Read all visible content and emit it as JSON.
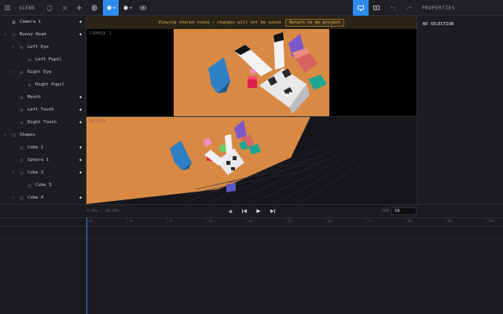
{
  "toolbar": {
    "menu_icon": "hamburger-menu-icon",
    "scene_label": "SCENE",
    "save_icon": "shield-icon",
    "close_icon": "close-icon",
    "add_icon": "plus-icon",
    "target_icon": "crosshair-icon",
    "shape_tool_icon": "circle-icon",
    "material_tool_icon": "sphere-icon",
    "view_icon": "eye-icon",
    "monitor_icon": "monitor-icon",
    "video_icon": "video-icon",
    "undo_icon": "undo-icon",
    "redo_icon": "redo-icon"
  },
  "scene_tree": [
    {
      "label": "Camera 1",
      "icon": "camera-icon",
      "depth": 0,
      "expandable": false,
      "visible_marker": true
    },
    {
      "label": "Bunny Head",
      "icon": "circle-icon",
      "depth": 0,
      "expandable": true,
      "visible_marker": true
    },
    {
      "label": "Left Eye",
      "icon": "diamond-icon",
      "depth": 1,
      "expandable": true,
      "visible_marker": false
    },
    {
      "label": "Left Pupil",
      "icon": "diamond-icon",
      "depth": 2,
      "expandable": false,
      "visible_marker": false
    },
    {
      "label": "Right Eye",
      "icon": "diamond-icon",
      "depth": 1,
      "expandable": true,
      "visible_marker": false
    },
    {
      "label": "Right Pupil",
      "icon": "diamond-icon",
      "depth": 2,
      "expandable": false,
      "visible_marker": false
    },
    {
      "label": "Mouth",
      "icon": "diamond-icon",
      "depth": 1,
      "expandable": false,
      "visible_marker": true
    },
    {
      "label": "Left Tooth",
      "icon": "diamond-icon",
      "depth": 1,
      "expandable": false,
      "visible_marker": true
    },
    {
      "label": "Right Tooth",
      "icon": "diamond-icon",
      "depth": 1,
      "expandable": false,
      "visible_marker": true
    },
    {
      "label": "Shapes",
      "icon": "square-icon",
      "depth": 0,
      "expandable": true,
      "visible_marker": false
    },
    {
      "label": "Cube 1",
      "icon": "circle-icon",
      "depth": 1,
      "expandable": false,
      "visible_marker": true
    },
    {
      "label": "Sphere 1",
      "icon": "circle-icon",
      "depth": 1,
      "expandable": false,
      "visible_marker": true
    },
    {
      "label": "Cube 2",
      "icon": "circle-icon",
      "depth": 1,
      "expandable": true,
      "visible_marker": true
    },
    {
      "label": "Cube 3",
      "icon": "circle-icon",
      "depth": 2,
      "expandable": false,
      "visible_marker": false
    },
    {
      "label": "Cube 4",
      "icon": "circle-icon",
      "depth": 1,
      "expandable": true,
      "visible_marker": true
    }
  ],
  "banner": {
    "message": "Viewing shared scene — changes will not be saved",
    "button_label": "Return to my project"
  },
  "viewports": {
    "camera_label": "CAMERA 1",
    "editor_label": "EDITOR"
  },
  "properties": {
    "title": "PROPERTIES",
    "selection_text": "NO SELECTION"
  },
  "timeline": {
    "time_display": "0.00s / 10.00s",
    "record_icon": "record-dot-icon",
    "skip_back_icon": "skip-back-icon",
    "play_icon": "play-icon",
    "skip_forward_icon": "skip-forward-icon",
    "dur_label": "DUR",
    "duration_value": "10",
    "ticks": [
      "0s",
      "1s",
      "2s",
      "3s",
      "4s",
      "5s",
      "6s",
      "7s",
      "8s",
      "9s",
      "10s"
    ]
  },
  "colors": {
    "accent": "#2d8cf0",
    "scene_background": "#d88a45",
    "banner_text": "#d4a855",
    "viewport_black": "#000000"
  }
}
